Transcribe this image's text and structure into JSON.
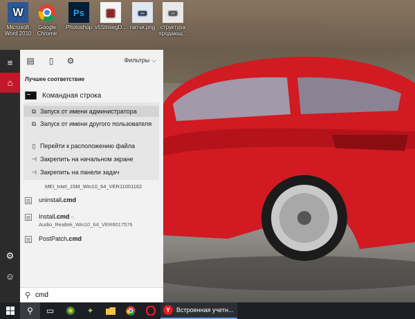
{
  "desktop": {
    "icons": [
      {
        "label": "Microsoft Word 2010",
        "glyph": "W",
        "bg": "#2b5797",
        "fg": "#ffffff"
      },
      {
        "label": "Google Chrome",
        "glyph": "●",
        "bg": "transparent",
        "fg": "#e0a800"
      },
      {
        "label": "Photoshop",
        "glyph": "Ps",
        "bg": "#001e36",
        "fg": "#31a8ff"
      },
      {
        "label": "v5SttniegD...",
        "glyph": "▤",
        "bg": "#f4f4f4",
        "fg": "#c62828"
      },
      {
        "label": "патчи.png",
        "glyph": "▭",
        "bg": "#dfe7f0",
        "fg": "#1b3a6b"
      },
      {
        "label": "структура продающ...",
        "glyph": "▭",
        "bg": "#e9e9e9",
        "fg": "#555555"
      }
    ]
  },
  "panel": {
    "filters_label": "Фильтры",
    "best_match_title": "Лучшее соответствие",
    "best_match_item": "Командная строка",
    "context_menu": [
      {
        "label": "Запуск от имени администратора",
        "icon": "⧉"
      },
      {
        "label": "Запуск от имени другого пользователя",
        "icon": "⧉"
      },
      {
        "label": "Перейти к расположению файла",
        "icon": "▯"
      },
      {
        "label": "Закрепить на начальном экране",
        "icon": "⊣"
      },
      {
        "label": "Закрепить на панели задач",
        "icon": "⊣"
      }
    ],
    "first_result_subtitle": "MEI_Intel_15M_Win10_64_VER11001162",
    "results": [
      {
        "name": "uninstall",
        "ext": ".cmd",
        "extra": "",
        "subtitle": ""
      },
      {
        "name": "Install",
        "ext": ".cmd",
        "extra": " -:",
        "subtitle": "Audio_Realtek_Win10_64_VER6017576"
      },
      {
        "name": "PostPatch",
        "ext": ".cmd",
        "extra": "",
        "subtitle": ""
      }
    ]
  },
  "search": {
    "value": "cmd"
  },
  "taskbar": {
    "active_app_label": "Встроенная учетн..."
  },
  "colors": {
    "accent": "#c5162a",
    "rail": "#2b2b2b",
    "panel": "#f2f2f2",
    "taskbar": "#1e1f24"
  }
}
